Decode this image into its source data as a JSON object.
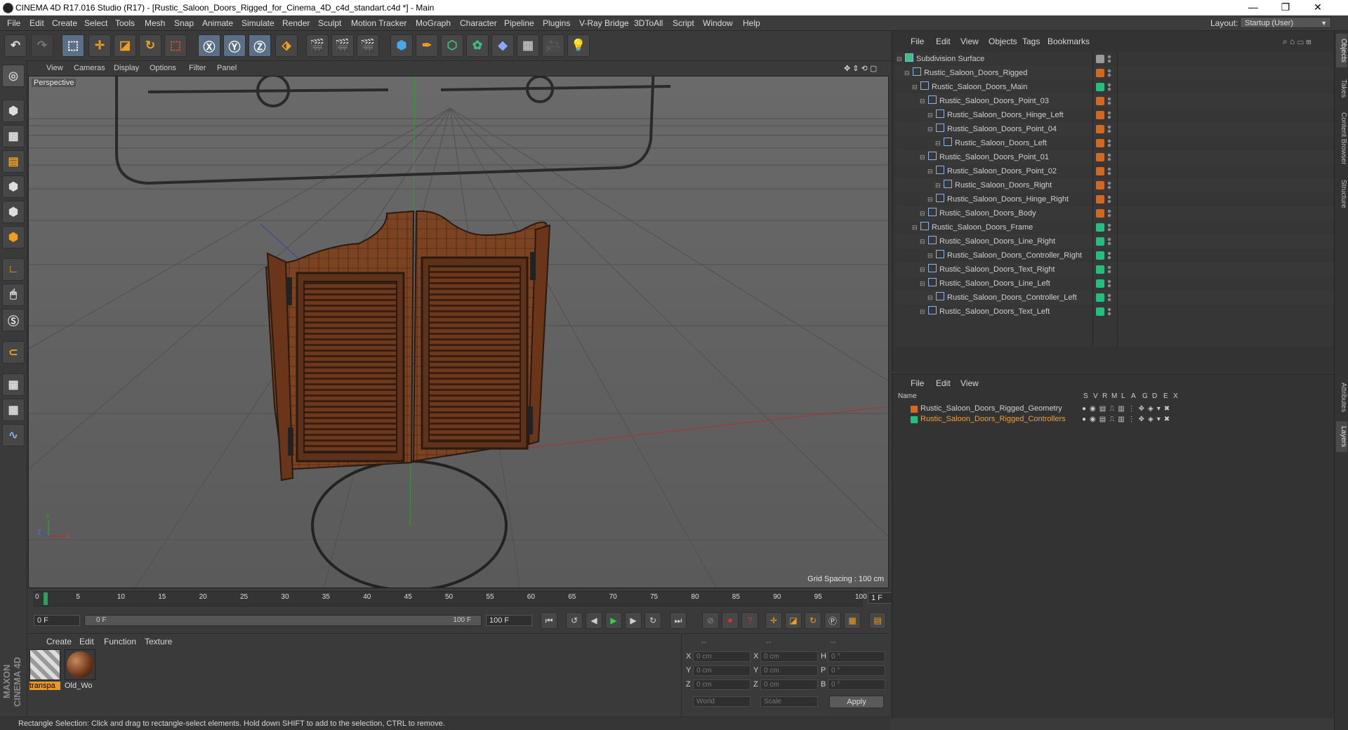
{
  "window": {
    "title": "CINEMA 4D R17.016 Studio (R17) - [Rustic_Saloon_Doors_Rigged_for_Cinema_4D_c4d_standart.c4d *] - Main",
    "controls": [
      "—",
      "❐",
      "✕"
    ]
  },
  "menu": {
    "items": [
      "File",
      "Edit",
      "Create",
      "Select",
      "Tools",
      "Mesh",
      "Snap",
      "Animate",
      "Simulate",
      "Render",
      "Sculpt",
      "Motion Tracker",
      "MoGraph",
      "Character",
      "Pipeline",
      "Plugins",
      "V-Ray Bridge",
      "3DToAll",
      "Script",
      "Window",
      "Help"
    ],
    "layout_label": "Layout:",
    "layout_value": "Startup (User)"
  },
  "viewport": {
    "menu": [
      "View",
      "Cameras",
      "Display",
      "Options",
      "Filter",
      "Panel"
    ],
    "label": "Perspective",
    "grid_spacing": "Grid Spacing : 100 cm",
    "axis_labels": [
      "Y",
      "X",
      "Z"
    ]
  },
  "timeline": {
    "ticks": [
      "0",
      "5",
      "10",
      "15",
      "20",
      "25",
      "30",
      "35",
      "40",
      "45",
      "50",
      "55",
      "60",
      "65",
      "70",
      "75",
      "80",
      "85",
      "90",
      "95",
      "100"
    ],
    "current_frame": "1 F",
    "start_field": "0 F",
    "range_start": "0 F",
    "range_end": "100 F",
    "end_field": "100 F"
  },
  "materials": {
    "menu": [
      "Create",
      "Edit",
      "Function",
      "Texture"
    ],
    "items": [
      {
        "name": "transpa",
        "selected": true
      },
      {
        "name": "Old_Wo",
        "selected": false
      }
    ]
  },
  "coordinates": {
    "headers": [
      "--",
      "--",
      "--"
    ],
    "rows": [
      {
        "l1": "X",
        "v1": "0 cm",
        "l2": "X",
        "v2": "0 cm",
        "l3": "H",
        "v3": "0 °"
      },
      {
        "l1": "Y",
        "v1": "0 cm",
        "l2": "Y",
        "v2": "0 cm",
        "l3": "P",
        "v3": "0 °"
      },
      {
        "l1": "Z",
        "v1": "0 cm",
        "l2": "Z",
        "v2": "0 cm",
        "l3": "B",
        "v3": "0 °"
      }
    ],
    "mode_world": "World",
    "mode_scale": "Scale",
    "apply": "Apply"
  },
  "status": {
    "text": "Rectangle Selection: Click and drag to rectangle-select elements. Hold down SHIFT to add to the selection, CTRL to remove."
  },
  "object_manager": {
    "menu": [
      "File",
      "Edit",
      "View",
      "Objects",
      "Tags",
      "Bookmarks"
    ],
    "objects": [
      {
        "name": "Subdivision Surface",
        "indent": 0,
        "color": "#9a9a9a"
      },
      {
        "name": "Rustic_Saloon_Doors_Rigged",
        "indent": 1,
        "color": "#d2691e"
      },
      {
        "name": "Rustic_Saloon_Doors_Main",
        "indent": 2,
        "color": "#20c080"
      },
      {
        "name": "Rustic_Saloon_Doors_Point_03",
        "indent": 3,
        "color": "#d2691e"
      },
      {
        "name": "Rustic_Saloon_Doors_Hinge_Left",
        "indent": 4,
        "color": "#d2691e"
      },
      {
        "name": "Rustic_Saloon_Doors_Point_04",
        "indent": 4,
        "color": "#d2691e"
      },
      {
        "name": "Rustic_Saloon_Doors_Left",
        "indent": 5,
        "color": "#d2691e"
      },
      {
        "name": "Rustic_Saloon_Doors_Point_01",
        "indent": 3,
        "color": "#d2691e"
      },
      {
        "name": "Rustic_Saloon_Doors_Point_02",
        "indent": 4,
        "color": "#d2691e"
      },
      {
        "name": "Rustic_Saloon_Doors_Right",
        "indent": 5,
        "color": "#d2691e"
      },
      {
        "name": "Rustic_Saloon_Doors_Hinge_Right",
        "indent": 4,
        "color": "#d2691e"
      },
      {
        "name": "Rustic_Saloon_Doors_Body",
        "indent": 3,
        "color": "#d2691e"
      },
      {
        "name": "Rustic_Saloon_Doors_Frame",
        "indent": 2,
        "color": "#20c080"
      },
      {
        "name": "Rustic_Saloon_Doors_Line_Right",
        "indent": 3,
        "color": "#20c080"
      },
      {
        "name": "Rustic_Saloon_Doors_Controller_Right",
        "indent": 4,
        "color": "#20c080"
      },
      {
        "name": "Rustic_Saloon_Doors_Text_Right",
        "indent": 3,
        "color": "#20c080"
      },
      {
        "name": "Rustic_Saloon_Doors_Line_Left",
        "indent": 3,
        "color": "#20c080"
      },
      {
        "name": "Rustic_Saloon_Doors_Controller_Left",
        "indent": 4,
        "color": "#20c080"
      },
      {
        "name": "Rustic_Saloon_Doors_Text_Left",
        "indent": 3,
        "color": "#20c080"
      }
    ]
  },
  "layer_manager": {
    "menu": [
      "File",
      "Edit",
      "View"
    ],
    "headers": [
      "Name",
      "S",
      "V",
      "R",
      "M",
      "L",
      "A",
      "G",
      "D",
      "E",
      "X"
    ],
    "layers": [
      {
        "name": "Rustic_Saloon_Doors_Rigged_Geometry",
        "color": "#d2691e",
        "text_color": "#d0d0d0"
      },
      {
        "name": "Rustic_Saloon_Doors_Rigged_Controllers",
        "color": "#20c080",
        "text_color": "#f0a030"
      }
    ]
  },
  "right_tabs": [
    "Objects",
    "Takes",
    "Content Browser",
    "Structure",
    "Attributes",
    "Layers"
  ],
  "brand": "MAXON CINEMA 4D"
}
